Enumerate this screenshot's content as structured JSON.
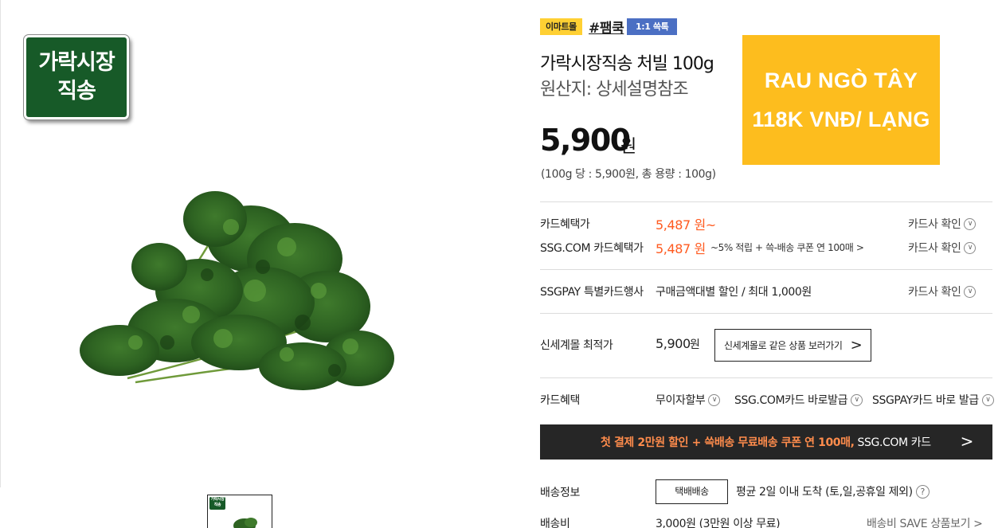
{
  "product_image": {
    "badge_line1": "가락시장",
    "badge_line2": "직송"
  },
  "tags": {
    "emart": "이마트몰",
    "hashtag": "#팸쿡",
    "kakao": "1:1 쓱톡"
  },
  "product": {
    "title": "가락시장직송 처빌 100g",
    "origin": "원산지: 상세설명참조",
    "price": "5,900",
    "currency": "원",
    "unit_price": "(100g 당 : 5,900원, 총 용량 : 100g)"
  },
  "promo_overlay": {
    "line1": "RAU NGÒ TÂY",
    "line2": "118K VNĐ/ LẠNG",
    "color": "#fdbd1e"
  },
  "benefits": {
    "card_label": "카드혜택가",
    "card_price": "5,487 원~",
    "card_check": "카드사 확인",
    "ssg_label": "SSG.COM 카드혜택가",
    "ssg_price": "5,487 원",
    "ssg_desc": "~5% 적립 + 쓱-배송 쿠폰 연 100매 >",
    "ssg_check": "카드사 확인",
    "ssgpay_label": "SSGPAY 특별카드행사",
    "ssgpay_desc": "구매금액대별 할인 / 최대 1,000원",
    "ssgpay_check": "카드사 확인",
    "accent_color": "#ff5a1f"
  },
  "lowest": {
    "label": "신세계몰 최적가",
    "price": "5,900",
    "currency": "원",
    "button": "신세계몰로 같은 상품 보러가기",
    "button_arrow": ">"
  },
  "card_benefit": {
    "label": "카드혜택",
    "opt1": "무이자할부",
    "opt2": "SSG.COM카드 바로발급",
    "opt3": "SSGPAY카드 바로 발급"
  },
  "banner": {
    "highlight": "첫 결제 2만원 할인 + 쓱배송 무료배송 쿠폰 연 100매,",
    "card_name": "SSG.COM 카드",
    "arrow": ">"
  },
  "shipping": {
    "label": "배송정보",
    "method": "택배배송",
    "desc": "평균 2일 이내 도착 (토,일,공휴일 제외)",
    "help": "?",
    "fee_label": "배송비",
    "fee": "3,000원 (3만원 이상 무료)",
    "save_link": "배송비 SAVE 상품보기 >"
  },
  "icons": {
    "chevron_circle": "chevron-down-circle-icon",
    "help": "question-circle-icon"
  }
}
